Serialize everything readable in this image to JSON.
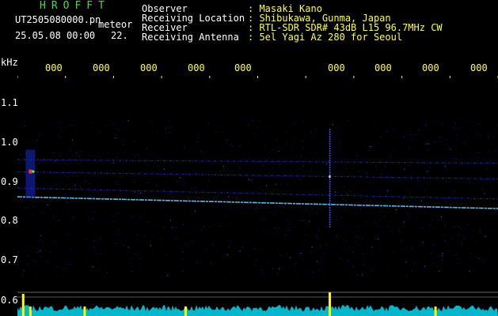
{
  "header": {
    "app_name": "HROFFT",
    "file_name": "UT2505080000.pn",
    "mode": "meteor",
    "date_time": "25.05.08 00:00",
    "value": "22.",
    "fields": [
      {
        "label": "Observer",
        "value": ": Masaki Kano"
      },
      {
        "label": "Receiving Location",
        "value": ": Shibukawa, Gunma, Japan"
      },
      {
        "label": "Receiver",
        "value": ": RTL-SDR SDR# 43dB L15 96.7MHz CW"
      },
      {
        "label": "Receiving Antenna",
        "value": ": 5el Yagi Az 280 for Seoul"
      }
    ]
  },
  "axes": {
    "y_unit": "kHz",
    "y_ticks": [
      "1.1",
      "1.0",
      "0.9",
      "0.8",
      "0.7",
      "0.6"
    ],
    "x_ticks": [
      "000",
      "000",
      "000",
      "000",
      "000",
      "000",
      "000",
      "000",
      "000",
      "0010"
    ]
  },
  "colors": {
    "background": "#000000",
    "header_title": "#44dd44",
    "header_text": "#ffffff",
    "header_value": "#ffff44",
    "signal": "#2233ff",
    "signal_bright": "#66ccff",
    "level_trace": "#00e5ff",
    "level_peak": "#ffff00"
  },
  "chart_data": {
    "type": "heatmap",
    "ylabel": "kHz",
    "ylim": [
      0.58,
      1.13
    ],
    "xlim": [
      0,
      10
    ],
    "traces": [
      {
        "x": [
          0,
          10
        ],
        "y": [
          0.853,
          0.826
        ]
      },
      {
        "x": [
          0,
          10
        ],
        "y": [
          0.873,
          0.848
        ]
      },
      {
        "x": [
          0,
          10
        ],
        "y": [
          0.91,
          0.894
        ]
      },
      {
        "x": [
          0,
          10
        ],
        "y": [
          0.938,
          0.93
        ]
      }
    ],
    "events": [
      {
        "x": 0.27,
        "y": 0.91,
        "intensity": "strong"
      },
      {
        "x": 6.5,
        "y": 0.9,
        "intensity": "medium"
      }
    ],
    "level_peaks": [
      0.12,
      0.27,
      1.4,
      3.5,
      6.5,
      8.7
    ]
  }
}
